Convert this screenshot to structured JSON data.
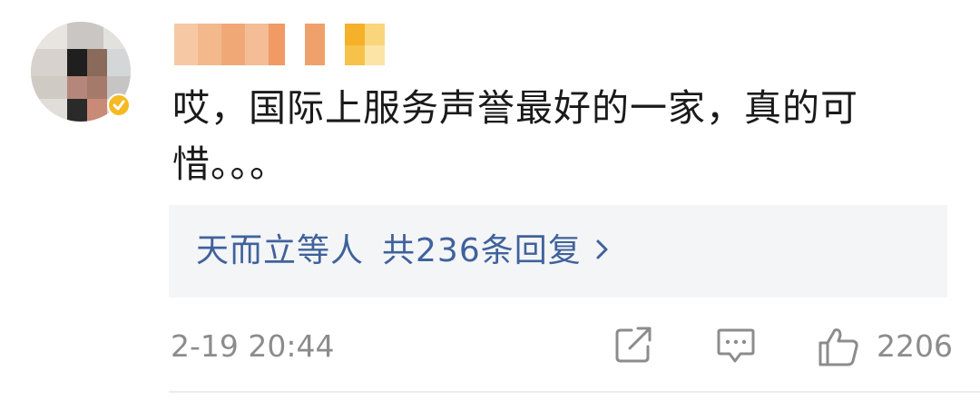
{
  "comment": {
    "text": "哎，国际上服务声誉最好的一家，真的可惜。。。",
    "replies": {
      "users": "天而立等人",
      "count_text": "共236条回复"
    },
    "timestamp": "2-19 20:44",
    "likes": "2206"
  },
  "icons": {
    "share": "share-icon",
    "comment": "comment-icon",
    "like": "thumbs-up-icon",
    "chevron": "chevron-right-icon",
    "verified": "verified-badge-icon"
  },
  "colors": {
    "link": "#40629b",
    "meta_text": "#8c8c8c",
    "reply_bg": "#f4f5f7",
    "verified_badge": "#f5b921"
  }
}
